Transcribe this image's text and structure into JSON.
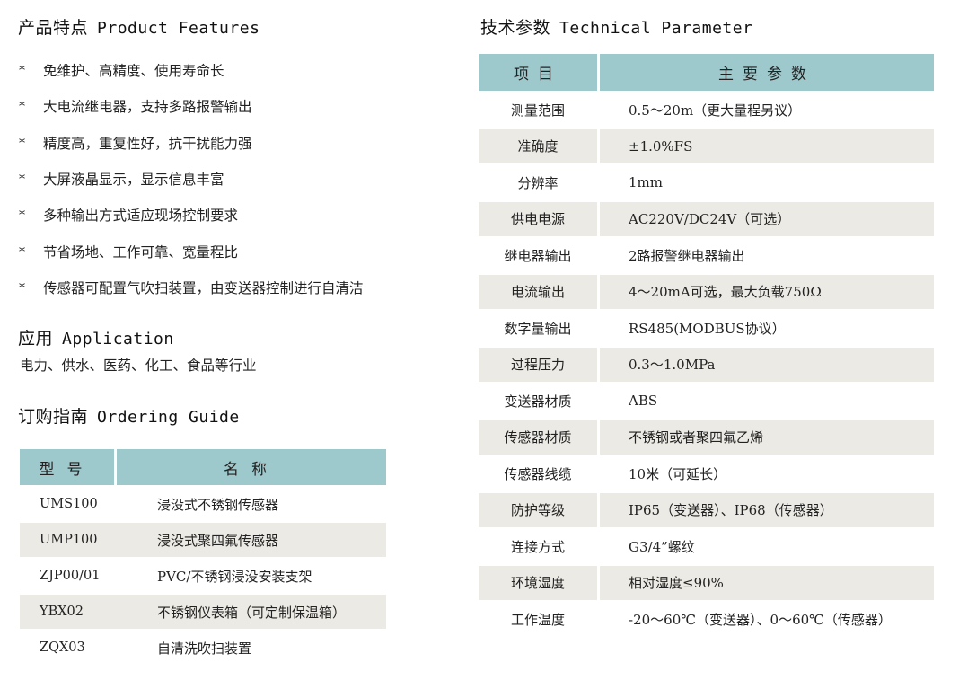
{
  "features": {
    "title_cn": "产品特点",
    "title_en": "Product Features",
    "items": [
      "免维护、高精度、使用寿命长",
      "大电流继电器，支持多路报警输出",
      "精度高，重复性好，抗干扰能力强",
      "大屏液晶显示，显示信息丰富",
      "多种输出方式适应现场控制要求",
      "节省场地、工作可靠、宽量程比",
      "传感器可配置气吹扫装置，由变送器控制进行自清洁"
    ],
    "bullet": "*"
  },
  "application": {
    "title_cn": "应用",
    "title_en": "Application",
    "text": "电力、供水、医药、化工、食品等行业"
  },
  "ordering": {
    "title_cn": "订购指南",
    "title_en": "Ordering Guide",
    "headers": [
      "型号",
      "名称"
    ],
    "rows": [
      [
        "UMS100",
        "浸没式不锈钢传感器"
      ],
      [
        "UMP100",
        "浸没式聚四氟传感器"
      ],
      [
        "ZJP00/01",
        "PVC/不锈钢浸没安装支架"
      ],
      [
        "YBX02",
        "不锈钢仪表箱（可定制保温箱）"
      ],
      [
        "ZQX03",
        "自清洗吹扫装置"
      ]
    ]
  },
  "technical": {
    "title_cn": "技术参数",
    "title_en": "Technical Parameter",
    "headers": [
      "项目",
      "主要参数"
    ],
    "rows": [
      [
        "测量范围",
        "0.5～20m（更大量程另议）"
      ],
      [
        "准确度",
        "±1.0%FS"
      ],
      [
        "分辨率",
        "1mm"
      ],
      [
        "供电电源",
        "AC220V/DC24V（可选）"
      ],
      [
        "继电器输出",
        "2路报警继电器输出"
      ],
      [
        "电流输出",
        "4～20mA可选，最大负载750Ω"
      ],
      [
        "数字量输出",
        "RS485(MODBUS协议）"
      ],
      [
        "过程压力",
        "0.3～1.0MPa"
      ],
      [
        "变送器材质",
        "ABS"
      ],
      [
        "传感器材质",
        "不锈钢或者聚四氟乙烯"
      ],
      [
        "传感器线缆",
        "10米（可延长）"
      ],
      [
        "防护等级",
        "IP65（变送器）、IP68（传感器）"
      ],
      [
        "连接方式",
        "G3/4”螺纹"
      ],
      [
        "环境湿度",
        "相对湿度≤90%"
      ],
      [
        "工作温度",
        "-20～60℃（变送器）、0～60℃（传感器）"
      ]
    ]
  },
  "colors": {
    "header_bg": "#9dc8cc",
    "row_shade": "#eceae4"
  }
}
